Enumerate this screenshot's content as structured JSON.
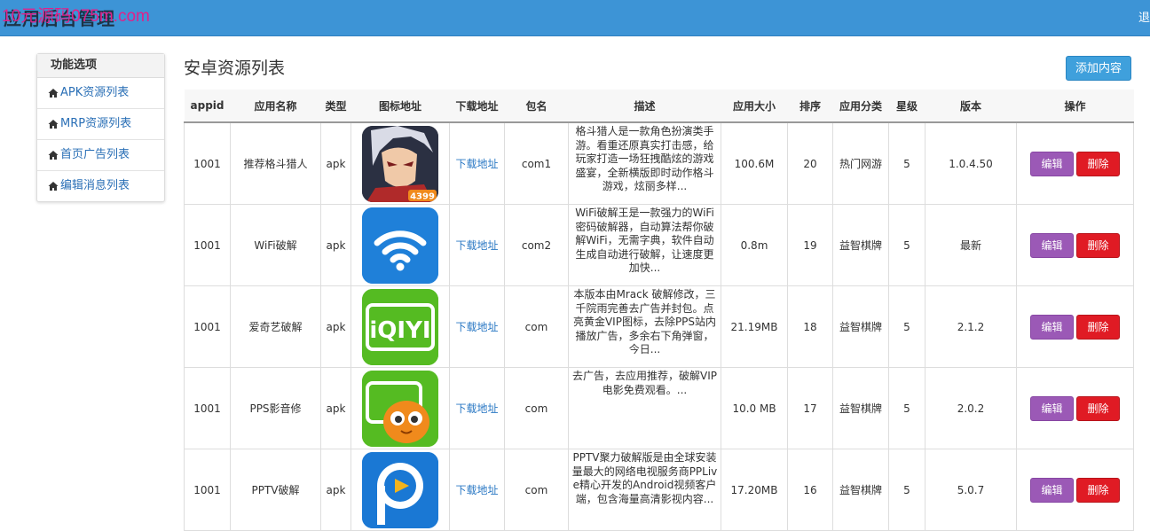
{
  "header": {
    "title": "应用后台管理",
    "watermark": "10元源码075m.com",
    "right_text": "退"
  },
  "sidebar": {
    "title": "功能选项",
    "items": [
      {
        "label": "APK资源列表"
      },
      {
        "label": "MRP资源列表"
      },
      {
        "label": "首页广告列表"
      },
      {
        "label": "编辑消息列表"
      }
    ]
  },
  "main": {
    "title": "安卓资源列表",
    "add_label": "添加内容"
  },
  "table": {
    "columns": [
      "appid",
      "应用名称",
      "类型",
      "图标地址",
      "下载地址",
      "包名",
      "描述",
      "应用大小",
      "排序",
      "应用分类",
      "星级",
      "版本",
      "操作"
    ],
    "edit_label": "编辑",
    "delete_label": "删除",
    "rows": [
      {
        "appid": "1001",
        "name": "推荐格斗猎人",
        "type": "apk",
        "icon": "game-character-icon",
        "download": "下载地址",
        "package": "com1",
        "desc": "格斗猎人是一款角色扮演类手游。看重还原真实打击感，给玩家打造一场狂拽酷炫的游戏盛宴，全新横版即时动作格斗游戏，炫丽多样...",
        "size": "100.6M",
        "order": "20",
        "category": "热门网游",
        "stars": "5",
        "version": "1.0.4.50",
        "badge": "4399"
      },
      {
        "appid": "1001",
        "name": "WiFi破解",
        "type": "apk",
        "icon": "wifi-icon",
        "download": "下载地址",
        "package": "com2",
        "desc": "WiFi破解王是一款强力的WiFi密码破解器，自动算法帮你破解WiFi，无需字典，软件自动生成自动进行破解，让速度更加快...",
        "size": "0.8m",
        "order": "19",
        "category": "益智棋牌",
        "stars": "5",
        "version": "最新"
      },
      {
        "appid": "1001",
        "name": "爱奇艺破解",
        "type": "apk",
        "icon": "iqiyi-icon",
        "download": "下载地址",
        "package": "com",
        "desc": "本版本由Mrack 破解修改，三千院雨完善去广告并封包。点亮黄金VIP图标，去除PPS站内播放广告，多余右下角弹窗，今日...",
        "size": "21.19MB",
        "order": "18",
        "category": "益智棋牌",
        "stars": "5",
        "version": "2.1.2",
        "logo_text": "iQIYI"
      },
      {
        "appid": "1001",
        "name": "PPS影音修",
        "type": "apk",
        "icon": "pps-icon",
        "download": "下载地址",
        "package": "com",
        "desc": "去广告，去应用推荐，破解VIP电影免费观看。...",
        "size": "10.0 MB",
        "order": "17",
        "category": "益智棋牌",
        "stars": "5",
        "version": "2.0.2"
      },
      {
        "appid": "1001",
        "name": "PPTV破解",
        "type": "apk",
        "icon": "pptv-icon",
        "download": "下载地址",
        "package": "com",
        "desc": "PPTV聚力破解版是由全球安装量最大的网络电视服务商PPLive精心开发的Android视频客户端，包含海量高清影视内容...",
        "size": "17.20MB",
        "order": "16",
        "category": "益智棋牌",
        "stars": "5",
        "version": "5.0.7"
      }
    ]
  },
  "colors": {
    "topbar": "#3d94d6",
    "link": "#2a78c4",
    "edit": "#9b59b6",
    "delete": "#e01b24",
    "add": "#3fa0dc"
  }
}
